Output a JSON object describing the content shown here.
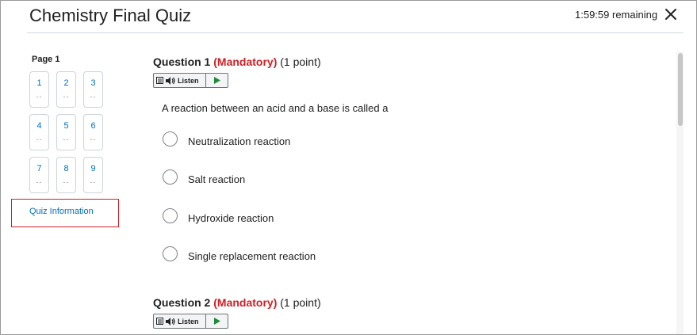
{
  "header": {
    "title": "Chemistry Final Quiz",
    "remaining": "1:59:59 remaining",
    "close_icon": "close-icon"
  },
  "nav": {
    "page_label": "Page 1",
    "questions": [
      {
        "num": "1",
        "status": "--"
      },
      {
        "num": "2",
        "status": "--"
      },
      {
        "num": "3",
        "status": "--"
      },
      {
        "num": "4",
        "status": "--"
      },
      {
        "num": "5",
        "status": "--"
      },
      {
        "num": "6",
        "status": "--"
      },
      {
        "num": "7",
        "status": "--"
      },
      {
        "num": "8",
        "status": "--"
      },
      {
        "num": "9",
        "status": "--"
      }
    ],
    "quiz_info": "Quiz Information"
  },
  "questions": [
    {
      "label": "Question 1",
      "mandatory": "(Mandatory)",
      "points": "(1 point)",
      "listen": "Listen",
      "text": "A reaction between an acid and a base is called a",
      "options": [
        "Neutralization reaction",
        "Salt reaction",
        "Hydroxide reaction",
        "Single replacement reaction"
      ]
    },
    {
      "label": "Question 2",
      "mandatory": "(Mandatory)",
      "points": "(1 point)",
      "listen": "Listen"
    }
  ],
  "colors": {
    "accent_link": "#006fbf",
    "mandatory": "#cd2026",
    "focus_outline": "#cd2026",
    "play_icon": "#1e8a3a"
  }
}
